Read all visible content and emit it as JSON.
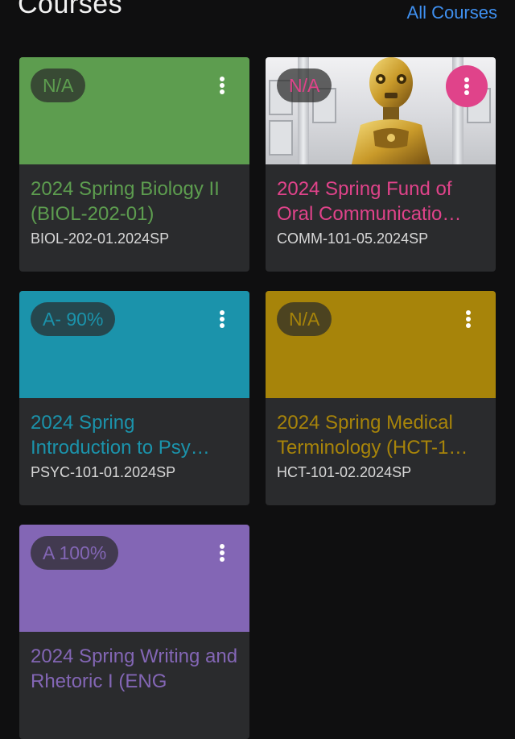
{
  "header": {
    "title": "Courses",
    "all_courses_label": "All Courses"
  },
  "courses": [
    {
      "grade": "N/A",
      "title": "2024 Spring Biology II (BIOL-202-01)",
      "code": "BIOL-202-01.2024SP",
      "color": "#5d9d4f",
      "has_image": false
    },
    {
      "grade": "N/A",
      "title": "2024 Spring Fund of Oral Communicatio…",
      "code": "COMM-101-05.2024SP",
      "color": "#e0438a",
      "has_image": true
    },
    {
      "grade": "A- 90%",
      "title": "2024 Spring Introduction to Psy…",
      "code": "PSYC-101-01.2024SP",
      "color": "#1b93ab",
      "has_image": false
    },
    {
      "grade": "N/A",
      "title": "2024 Spring Medical Terminology (HCT-1…",
      "code": "HCT-101-02.2024SP",
      "color": "#a7840a",
      "has_image": false
    },
    {
      "grade": "A 100%",
      "title": "2024 Spring Writing and Rhetoric I (ENG",
      "code": "",
      "color": "#8366b5",
      "has_image": false
    }
  ],
  "icons": {
    "menu": "more-vert-icon"
  }
}
